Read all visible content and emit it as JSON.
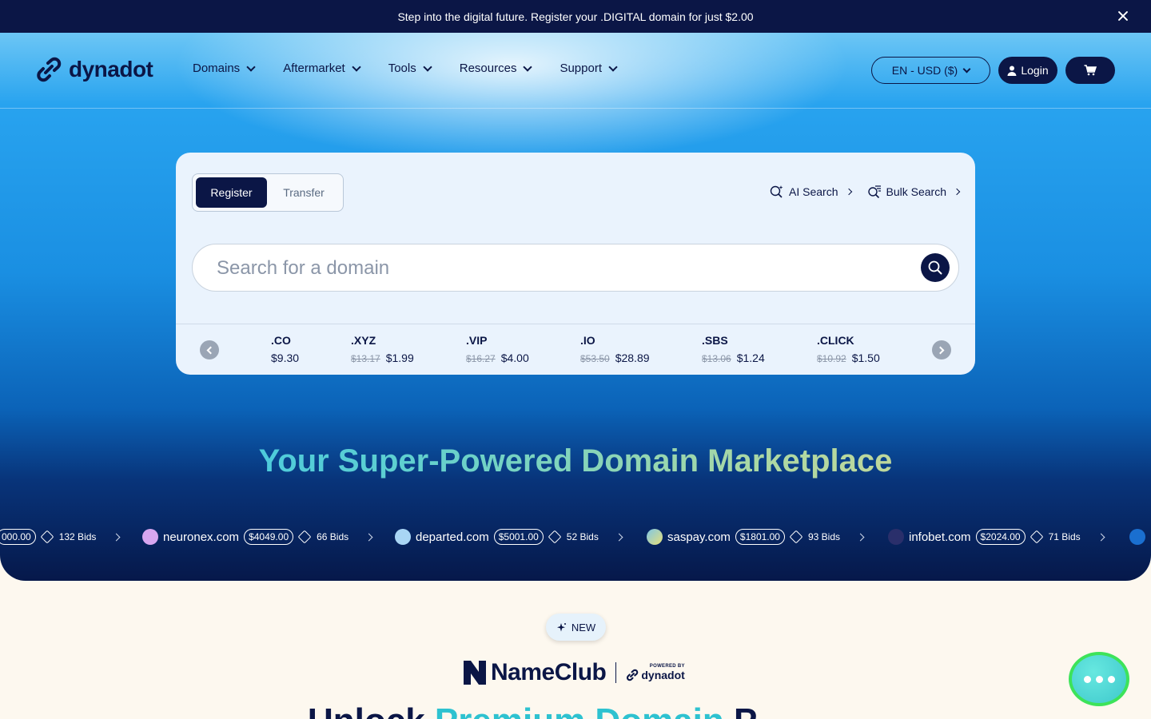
{
  "promo": {
    "text": "Step into the digital future. Register your .DIGITAL domain for just $2.00"
  },
  "header": {
    "logo": "dynadot",
    "nav": [
      "Domains",
      "Aftermarket",
      "Tools",
      "Resources",
      "Support"
    ],
    "lang_currency": "EN - USD ($)",
    "login_label": "Login"
  },
  "search": {
    "tabs": {
      "register": "Register",
      "transfer": "Transfer"
    },
    "links": {
      "ai": "AI Search",
      "bulk": "Bulk Search"
    },
    "placeholder": "Search for a domain",
    "tlds": [
      {
        "name": ".CO",
        "old": "",
        "price": "$9.30"
      },
      {
        "name": ".XYZ",
        "old": "$13.17",
        "price": "$1.99"
      },
      {
        "name": ".VIP",
        "old": "$16.27",
        "price": "$4.00"
      },
      {
        "name": ".IO",
        "old": "$53.50",
        "price": "$28.89"
      },
      {
        "name": ".SBS",
        "old": "$13.06",
        "price": "$1.24"
      },
      {
        "name": ".CLICK",
        "old": "$10.92",
        "price": "$1.50"
      }
    ]
  },
  "hero": {
    "headline": "Your Super-Powered Domain Marketplace"
  },
  "marquee": [
    {
      "name": "",
      "price": "000.00",
      "bids": "132 Bids",
      "dot_color": ""
    },
    {
      "name": "neuronex.com",
      "price": "$4049.00",
      "bids": "66 Bids",
      "dot_color": "#d7a6f0"
    },
    {
      "name": "departed.com",
      "price": "$5001.00",
      "bids": "52 Bids",
      "dot_color": "#a9d6f5"
    },
    {
      "name": "saspay.com",
      "price": "$1801.00",
      "bids": "93 Bids",
      "dot_color": "#d9e28c"
    },
    {
      "name": "infobet.com",
      "price": "$2024.00",
      "bids": "71 Bids",
      "dot_color": "#2a2f6b"
    }
  ],
  "lower": {
    "badge": "NEW",
    "brand": "NameClub",
    "powered_by": "POWERED BY",
    "powered_brand": "dynadot",
    "headline_start": "Unlock ",
    "headline_highlight": "Premium Domain",
    "headline_end": " P"
  },
  "colors": {
    "navy": "#0b1646",
    "accent": "#2ec2f0",
    "chat_ring": "#3de35a"
  }
}
